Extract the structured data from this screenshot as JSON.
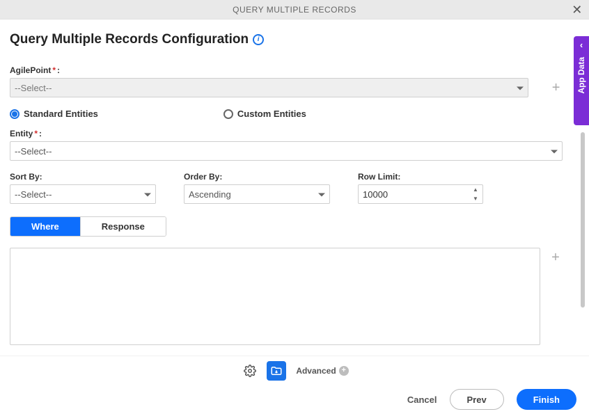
{
  "title_bar": {
    "title": "QUERY MULTIPLE RECORDS"
  },
  "header": {
    "page_title": "Query Multiple Records Configuration"
  },
  "fields": {
    "agilepoint_label": "AgilePoint ",
    "agilepoint_value": "--Select--",
    "entity_label": "Entity ",
    "entity_value": "--Select--",
    "sort_label": "Sort By:",
    "sort_value": "--Select--",
    "order_label": "Order By:",
    "order_value": "Ascending",
    "rowlimit_label": "Row Limit:",
    "rowlimit_value": "10000"
  },
  "entity_type": {
    "standard": "Standard Entities",
    "custom": "Custom Entities",
    "selected": "standard"
  },
  "tabs": {
    "where": "Where",
    "response": "Response",
    "active": "where"
  },
  "side_tab": {
    "label": "App Data"
  },
  "footer": {
    "advanced": "Advanced",
    "cancel": "Cancel",
    "prev": "Prev",
    "finish": "Finish"
  }
}
